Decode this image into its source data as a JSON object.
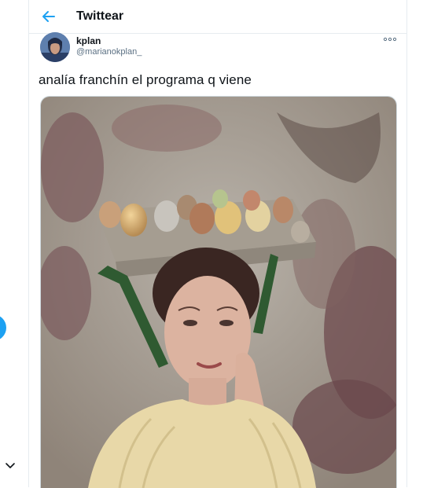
{
  "header": {
    "title": "Twittear",
    "back_icon": "arrow-left-icon"
  },
  "tweet": {
    "author": {
      "name": "kplan",
      "handle": "@marianokplan_"
    },
    "text": "analía franchín el programa q viene",
    "more_icon": "more-horizontal-icon"
  },
  "colors": {
    "accent": "#1da1f2",
    "text_primary": "#0f1419",
    "text_secondary": "#5b7083",
    "border": "#e6ecf0"
  }
}
